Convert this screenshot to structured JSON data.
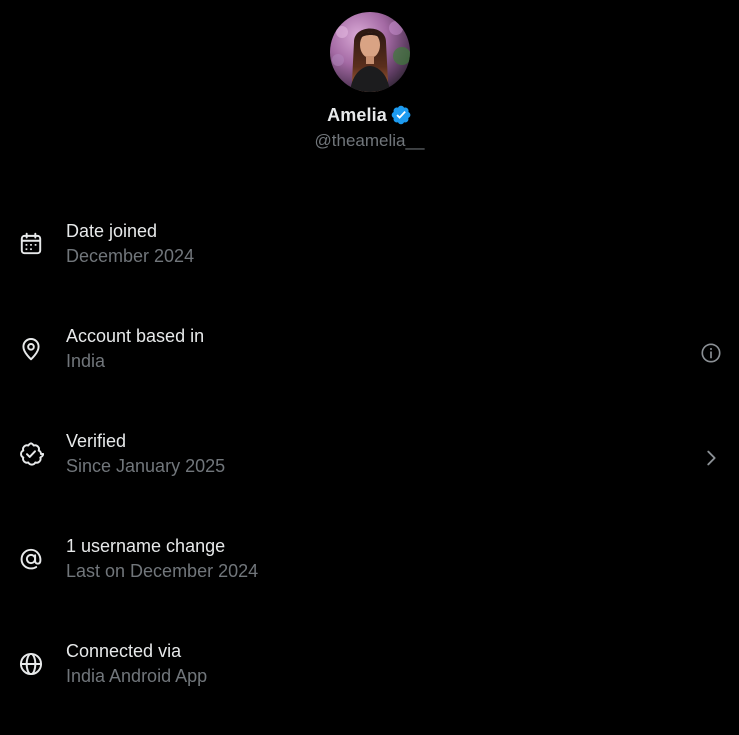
{
  "profile": {
    "display_name": "Amelia",
    "handle": "@theamelia__",
    "verified": true
  },
  "colors": {
    "background": "#000000",
    "primary_text": "#e7e9ea",
    "secondary_text": "#71767b",
    "verified_badge": "#1d9bf0"
  },
  "info_rows": [
    {
      "icon": "calendar-icon",
      "title": "Date joined",
      "subtitle": "December 2024",
      "action": ""
    },
    {
      "icon": "location-pin-icon",
      "title": "Account based in",
      "subtitle": "India",
      "action": "info-icon"
    },
    {
      "icon": "verified-outline-icon",
      "title": "Verified",
      "subtitle": "Since January 2025",
      "action": "chevron-right-icon"
    },
    {
      "icon": "at-sign-icon",
      "title": "1 username change",
      "subtitle": "Last on December 2024",
      "action": ""
    },
    {
      "icon": "globe-icon",
      "title": "Connected via",
      "subtitle": "India Android App",
      "action": ""
    }
  ]
}
